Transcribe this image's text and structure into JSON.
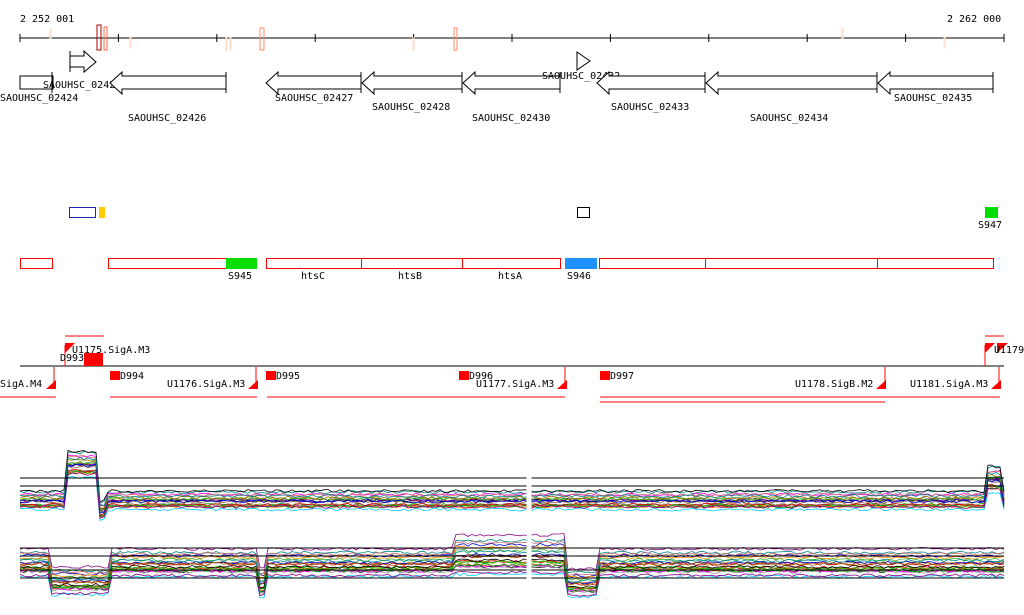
{
  "ruler": {
    "start_label": "2 252 001",
    "end_label": "2 262 000"
  },
  "genes": [
    "SAOUHSC_02424",
    "SAOUHSC_02425",
    "SAOUHSC_02426",
    "SAOUHSC_02427",
    "SAOUHSC_02428",
    "SAOUHSC_02430",
    "SAOUHSC_02432",
    "SAOUHSC_02433",
    "SAOUHSC_02434",
    "SAOUHSC_02435"
  ],
  "features": {
    "s945": "S945",
    "s946": "S946",
    "s947": "S947",
    "htsC": "htsC",
    "htsB": "htsB",
    "htsA": "htsA"
  },
  "promoters": [
    "U1175.SigA.M3",
    "D993",
    "D994",
    "D995",
    "D996",
    "D997",
    "SigA.M4",
    "U1176.SigA.M3",
    "U1177.SigA.M3",
    "U1178.SigB.M2",
    "U1181.SigA.M3",
    "U1179"
  ],
  "colors": {
    "accent_red": "#ff0000",
    "green": "#00dd00",
    "blue": "#1e90ff",
    "yellow": "#ffcc00"
  }
}
